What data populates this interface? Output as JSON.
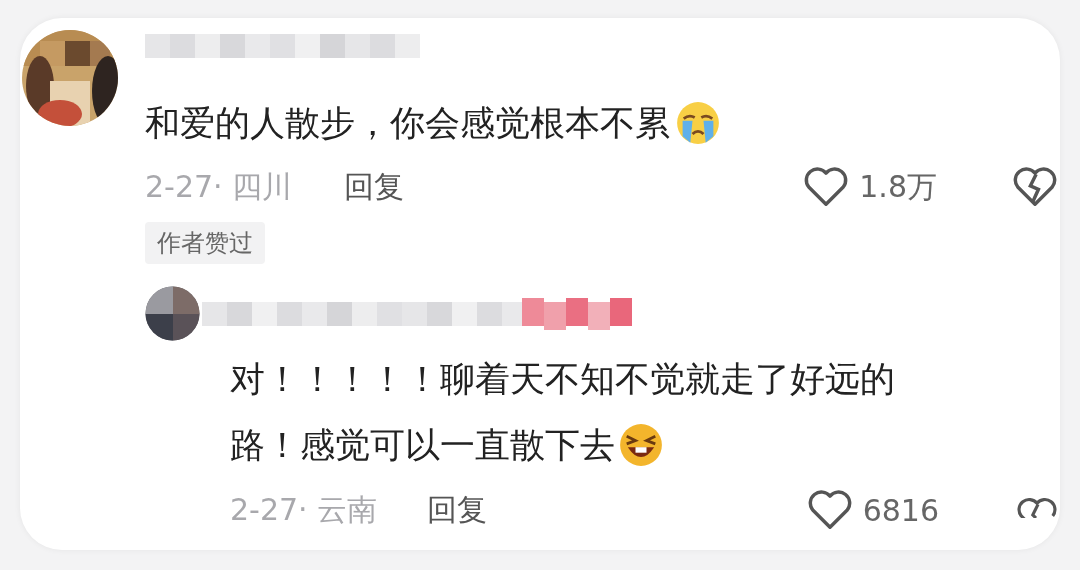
{
  "comment": {
    "text": "和爱的人散步，你会感觉根本不累",
    "date_place": "2-27· 四川",
    "reply_label": "回复",
    "likes": "1.8万",
    "badge": "作者赞过"
  },
  "reply": {
    "text": "对！！！！！聊着天不知不觉就走了好远的路！感觉可以一直散下去",
    "date_place": "2-27· 云南",
    "reply_label": "回复",
    "likes": "6816"
  }
}
